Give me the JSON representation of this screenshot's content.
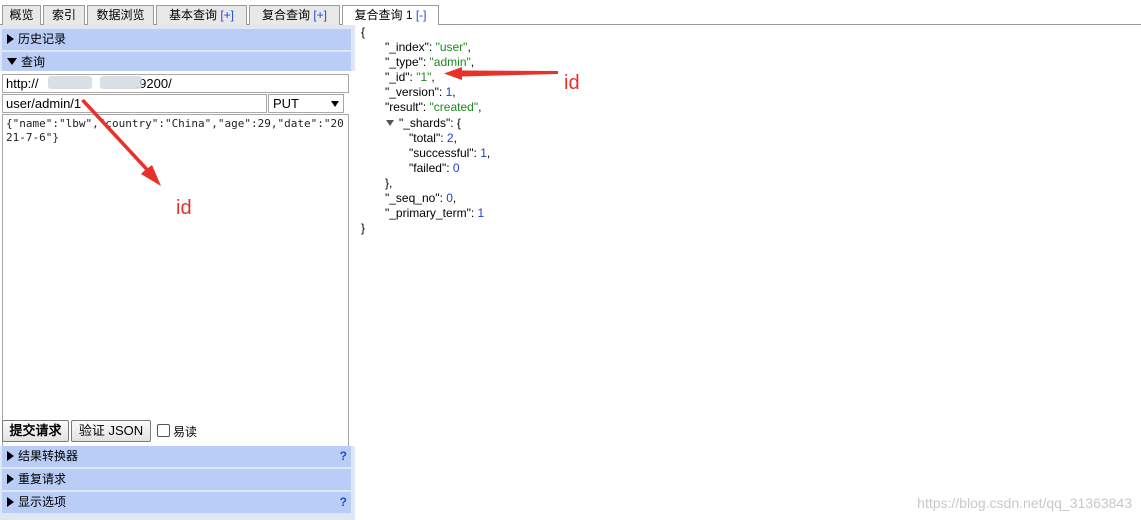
{
  "tabs": [
    {
      "label": "概览",
      "plus": ""
    },
    {
      "label": "索引",
      "plus": ""
    },
    {
      "label": "数据浏览",
      "plus": ""
    },
    {
      "label": "基本查询 ",
      "plus": "[+]"
    },
    {
      "label": "复合查询 ",
      "plus": "[+]"
    },
    {
      "label": "复合查询 1 ",
      "plus": "[-]"
    }
  ],
  "sections": {
    "history": "历史记录",
    "query": "查询",
    "transformer": "结果转换器",
    "repeat": "重复请求",
    "display": "显示选项",
    "help_mark": "?"
  },
  "query": {
    "url_prefix": "http://",
    "url_suffix": ".9200/",
    "path": "user/admin/1",
    "method": "PUT",
    "body": "{\"name\":\"lbw\",\"country\":\"China\",\"age\":29,\"date\":\"2021-7-6\"}",
    "submit_label": "提交请求",
    "validate_label": "验证 JSON",
    "readable_label": "易读"
  },
  "response": {
    "open": "{",
    "close": "}",
    "index_key": "\"_index\"",
    "index_val": "\"user\"",
    "type_key": "\"_type\"",
    "type_val": "\"admin\"",
    "id_key": "\"_id\"",
    "id_val": "\"1\"",
    "version_key": "\"_version\"",
    "version_val": "1",
    "result_key": "\"result\"",
    "result_val": "\"created\"",
    "shards_key": "\"_shards\"",
    "total_key": "\"total\"",
    "total_val": "2",
    "successful_key": "\"successful\"",
    "successful_val": "1",
    "failed_key": "\"failed\"",
    "failed_val": "0",
    "seq_key": "\"_seq_no\"",
    "seq_val": "0",
    "term_key": "\"_primary_term\"",
    "term_val": "1"
  },
  "annotations": {
    "label_right": "id",
    "label_left": "id",
    "color": "#e8312a"
  },
  "watermark": "https://blog.csdn.net/qq_31363843"
}
